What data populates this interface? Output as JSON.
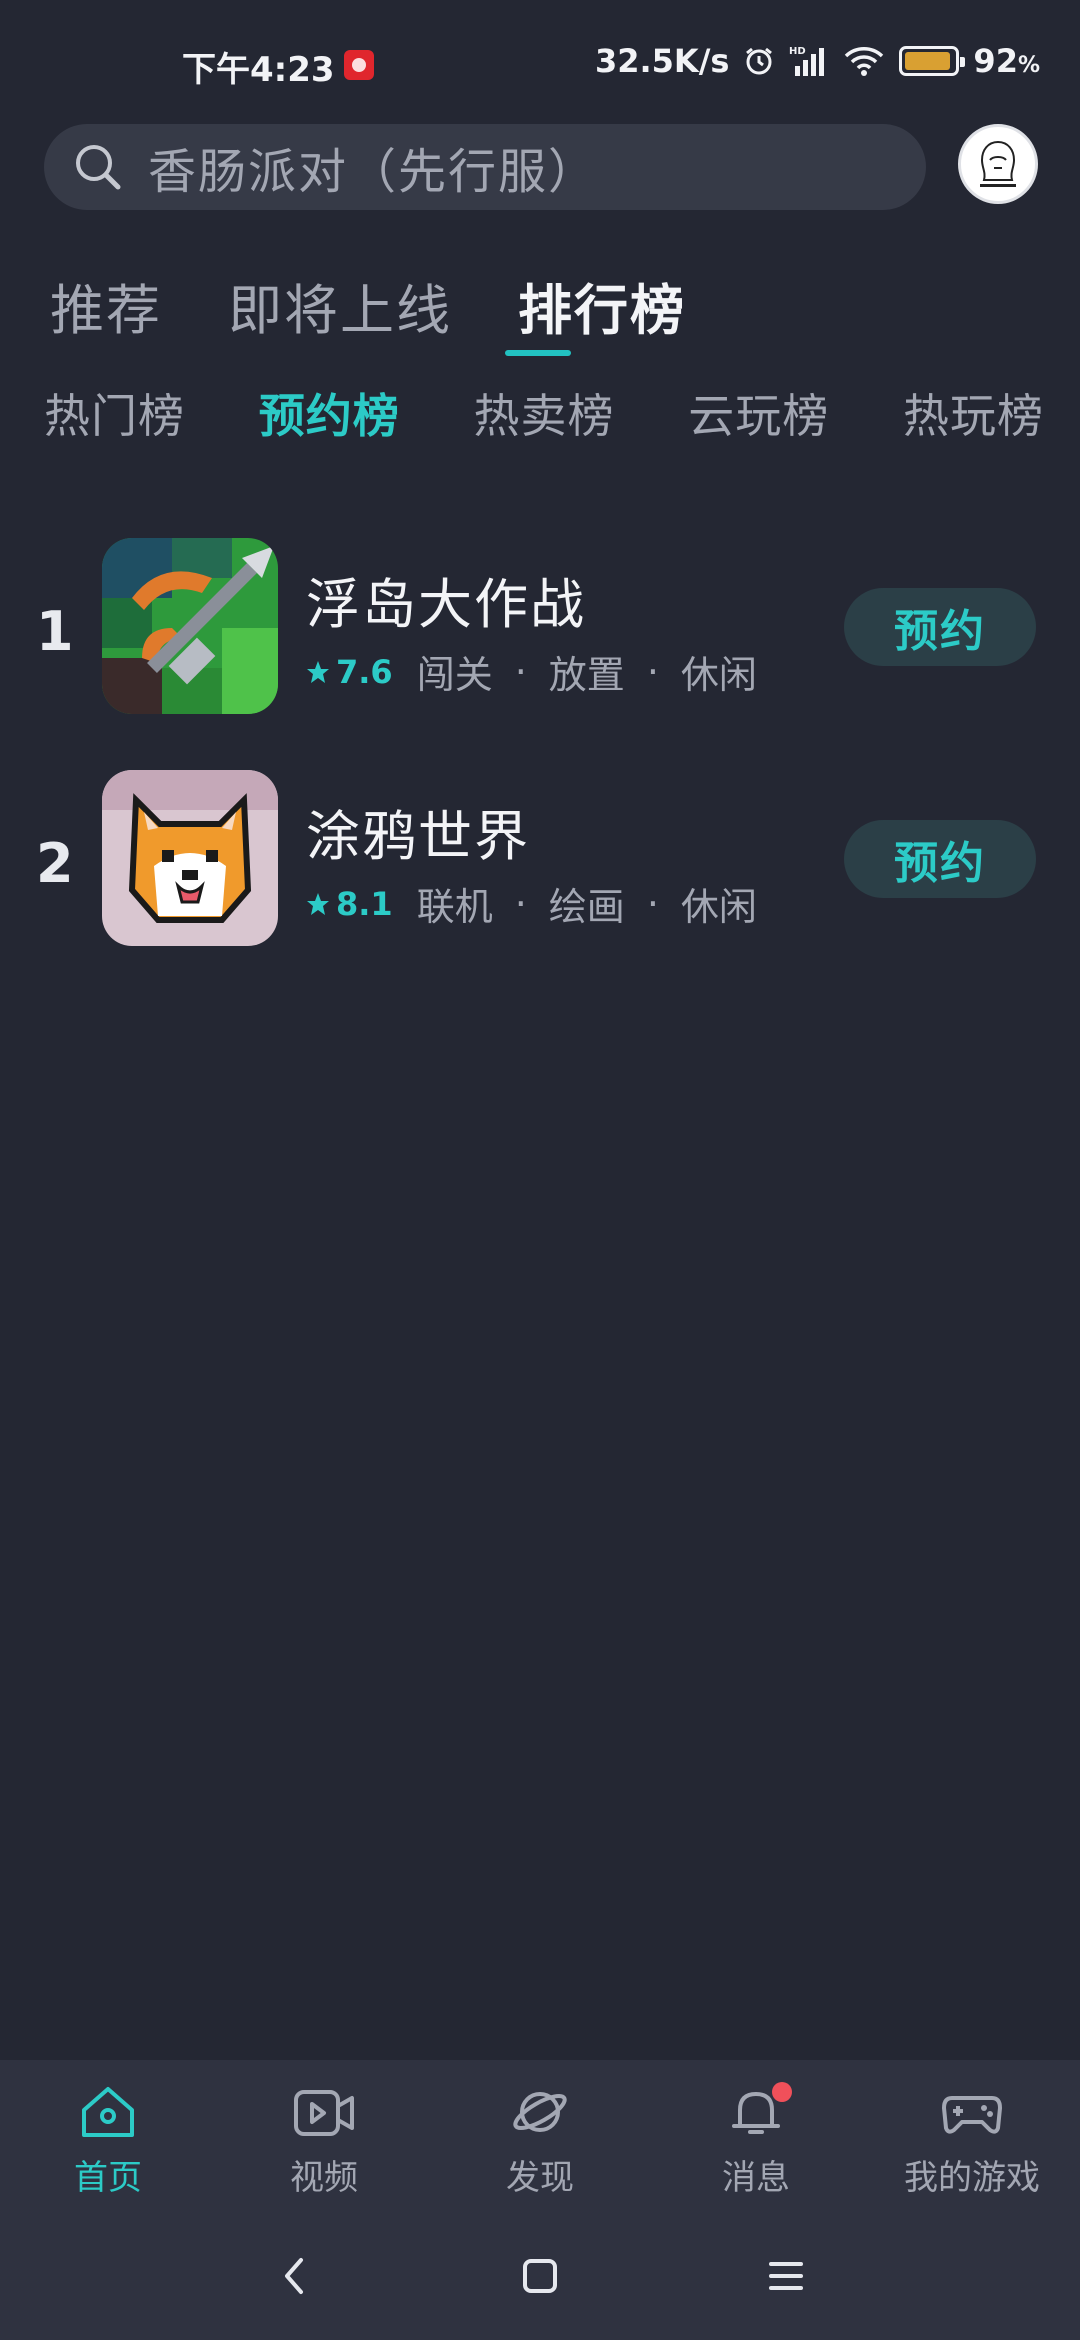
{
  "status": {
    "time": "下午4:23",
    "speed": "32.5K/s",
    "battery_pct": "92",
    "battery_unit": "%",
    "battery_level": 0.92
  },
  "search": {
    "placeholder": "香肠派对（先行服）"
  },
  "top_tabs": [
    {
      "label": "推荐"
    },
    {
      "label": "即将上线"
    },
    {
      "label": "排行榜"
    }
  ],
  "sub_tabs": [
    {
      "label": "热门榜"
    },
    {
      "label": "预约榜"
    },
    {
      "label": "热卖榜"
    },
    {
      "label": "云玩榜"
    },
    {
      "label": "热玩榜"
    }
  ],
  "games": [
    {
      "rank": "1",
      "title": "浮岛大作战",
      "rating": "7.6",
      "tags": [
        "闯关",
        "放置",
        "休闲"
      ],
      "action": "预约"
    },
    {
      "rank": "2",
      "title": "涂鸦世界",
      "rating": "8.1",
      "tags": [
        "联机",
        "绘画",
        "休闲"
      ],
      "action": "预约"
    }
  ],
  "bottom_nav": [
    {
      "label": "首页",
      "icon": "home-icon"
    },
    {
      "label": "视频",
      "icon": "video-icon"
    },
    {
      "label": "发现",
      "icon": "planet-icon"
    },
    {
      "label": "消息",
      "icon": "bell-icon"
    },
    {
      "label": "我的游戏",
      "icon": "gamepad-icon"
    }
  ],
  "colors": {
    "accent": "#2ccbc7",
    "background": "#242733",
    "badge": "#f0505a",
    "battery": "#d9a032"
  }
}
